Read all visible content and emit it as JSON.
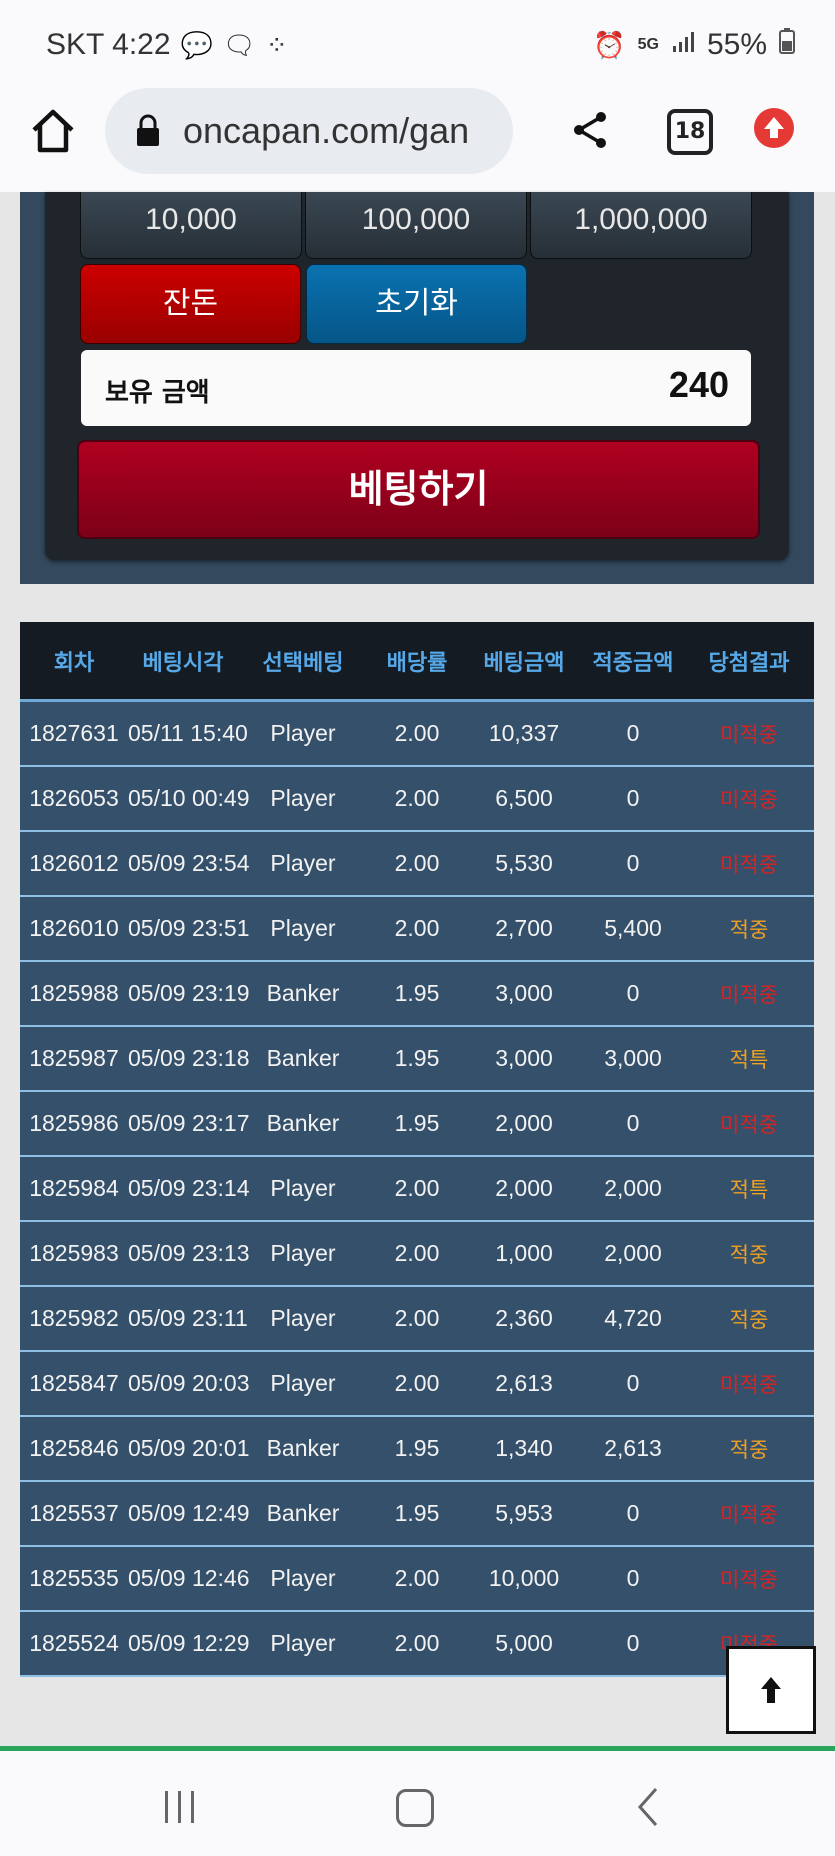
{
  "status": {
    "carrier_time": "SKT 4:22",
    "battery": "55%",
    "network": "5G"
  },
  "browser": {
    "url": "oncapan.com/gan",
    "tab_count": "18"
  },
  "chips": [
    "10,000",
    "100,000",
    "1,000,000"
  ],
  "buttons": {
    "change": "잔돈",
    "reset": "초기화",
    "bet": "베팅하기"
  },
  "balance": {
    "label": "보유 금액",
    "value": "240"
  },
  "table": {
    "headers": [
      "회차",
      "베팅시각",
      "선택베팅",
      "배당률",
      "베팅금액",
      "적중금액",
      "당첨결과"
    ],
    "rows": [
      {
        "round": "1827631",
        "time": "05/11 15:40",
        "pick": "Player",
        "odds": "2.00",
        "amount": "10,337",
        "win": "0",
        "result": "미적중",
        "hit": false
      },
      {
        "round": "1826053",
        "time": "05/10 00:49",
        "pick": "Player",
        "odds": "2.00",
        "amount": "6,500",
        "win": "0",
        "result": "미적중",
        "hit": false
      },
      {
        "round": "1826012",
        "time": "05/09 23:54",
        "pick": "Player",
        "odds": "2.00",
        "amount": "5,530",
        "win": "0",
        "result": "미적중",
        "hit": false
      },
      {
        "round": "1826010",
        "time": "05/09 23:51",
        "pick": "Player",
        "odds": "2.00",
        "amount": "2,700",
        "win": "5,400",
        "result": "적중",
        "hit": true
      },
      {
        "round": "1825988",
        "time": "05/09 23:19",
        "pick": "Banker",
        "odds": "1.95",
        "amount": "3,000",
        "win": "0",
        "result": "미적중",
        "hit": false
      },
      {
        "round": "1825987",
        "time": "05/09 23:18",
        "pick": "Banker",
        "odds": "1.95",
        "amount": "3,000",
        "win": "3,000",
        "result": "적특",
        "hit": true
      },
      {
        "round": "1825986",
        "time": "05/09 23:17",
        "pick": "Banker",
        "odds": "1.95",
        "amount": "2,000",
        "win": "0",
        "result": "미적중",
        "hit": false
      },
      {
        "round": "1825984",
        "time": "05/09 23:14",
        "pick": "Player",
        "odds": "2.00",
        "amount": "2,000",
        "win": "2,000",
        "result": "적특",
        "hit": true
      },
      {
        "round": "1825983",
        "time": "05/09 23:13",
        "pick": "Player",
        "odds": "2.00",
        "amount": "1,000",
        "win": "2,000",
        "result": "적중",
        "hit": true
      },
      {
        "round": "1825982",
        "time": "05/09 23:11",
        "pick": "Player",
        "odds": "2.00",
        "amount": "2,360",
        "win": "4,720",
        "result": "적중",
        "hit": true
      },
      {
        "round": "1825847",
        "time": "05/09 20:03",
        "pick": "Player",
        "odds": "2.00",
        "amount": "2,613",
        "win": "0",
        "result": "미적중",
        "hit": false
      },
      {
        "round": "1825846",
        "time": "05/09 20:01",
        "pick": "Banker",
        "odds": "1.95",
        "amount": "1,340",
        "win": "2,613",
        "result": "적중",
        "hit": true
      },
      {
        "round": "1825537",
        "time": "05/09 12:49",
        "pick": "Banker",
        "odds": "1.95",
        "amount": "5,953",
        "win": "0",
        "result": "미적중",
        "hit": false
      },
      {
        "round": "1825535",
        "time": "05/09 12:46",
        "pick": "Player",
        "odds": "2.00",
        "amount": "10,000",
        "win": "0",
        "result": "미적중",
        "hit": false
      },
      {
        "round": "1825524",
        "time": "05/09 12:29",
        "pick": "Player",
        "odds": "2.00",
        "amount": "5,000",
        "win": "0",
        "result": "미적중",
        "hit": false
      }
    ]
  },
  "colors": {
    "miss": "#d92323",
    "hit": "#f0a020",
    "header_text": "#56a8e8",
    "row_bg": "#35506a"
  },
  "icons": {
    "home": "home-icon",
    "lock": "lock-icon",
    "share": "share-icon",
    "update": "update-arrow-icon",
    "scroll_top": "arrow-up-icon"
  }
}
